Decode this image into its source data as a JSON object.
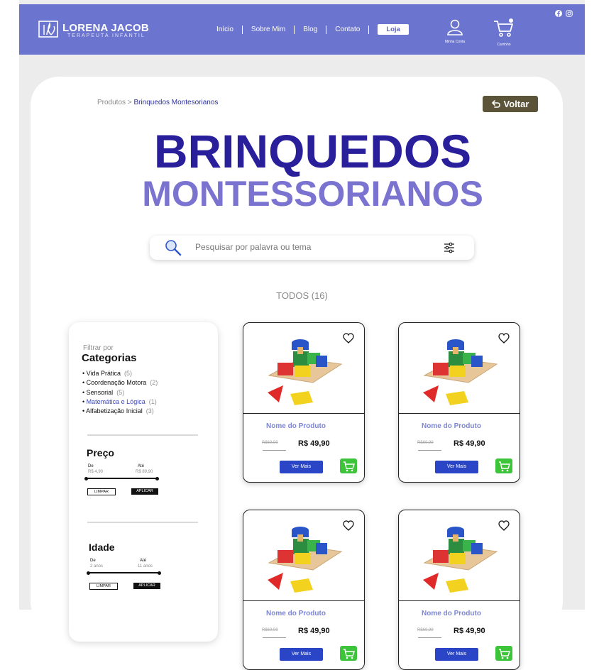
{
  "brand": {
    "name": "LORENA JACOB",
    "subtitle": "TERAPEUTA INFANTIL"
  },
  "nav": {
    "items": [
      "Início",
      "Sobre Mim",
      "Blog",
      "Contato"
    ],
    "store": "Loja"
  },
  "header_icons": {
    "account_label": "Minha Conta",
    "cart_label": "Carrinho",
    "cart_count": "0"
  },
  "breadcrumb": {
    "parent": "Produtos",
    "separator": ">",
    "current": "Brinquedos Montesorianos"
  },
  "back_button": "Voltar",
  "title": {
    "line1": "BRINQUEDOS",
    "line2": "MONTESSORIANOS"
  },
  "search": {
    "placeholder": "Pesquisar por palavra ou tema"
  },
  "results_label": "TODOS (16)",
  "filters": {
    "filter_by": "Filtrar por",
    "categories_title": "Categorias",
    "categories": [
      {
        "name": "Vida Prática",
        "count": "(5)"
      },
      {
        "name": "Coordenação Motora",
        "count": "(2)"
      },
      {
        "name": "Sensorial",
        "count": "(5)"
      },
      {
        "name": "Matemática e Lógica",
        "count": "(1)"
      },
      {
        "name": "Alfabetização Inicial",
        "count": "(3)"
      }
    ],
    "price": {
      "title": "Preço",
      "from_label": "De",
      "to_label": "Até",
      "from_value": "R$ 4,90",
      "to_value": "R$ 89,90",
      "clear": "LIMPAR",
      "apply": "APLICAR"
    },
    "age": {
      "title": "Idade",
      "from_label": "De",
      "to_label": "Até",
      "from_value": "2 anos",
      "to_value": "11 anos",
      "clear": "LIMPAR",
      "apply": "APLICAR"
    }
  },
  "products": [
    {
      "name": "Nome do Produto",
      "old_price": "R$69,99",
      "price": "R$ 49,90",
      "button": "Ver Mais"
    },
    {
      "name": "Nome do Produto",
      "old_price": "R$69,99",
      "price": "R$ 49,90",
      "button": "Ver Mais"
    },
    {
      "name": "Nome do Produto",
      "old_price": "R$69,99",
      "price": "R$ 49,90",
      "button": "Ver Mais"
    },
    {
      "name": "Nome do Produto",
      "old_price": "R$69,99",
      "price": "R$ 49,90",
      "button": "Ver Mais"
    }
  ],
  "colors": {
    "header": "#6b74cf",
    "title_dark": "#2a1f9a",
    "title_light": "#7a73d0",
    "button_blue": "#2a46c6",
    "cart_green": "#3ec43b",
    "back_button": "#5b5438"
  },
  "icons": [
    "facebook-icon",
    "instagram-icon",
    "user-icon",
    "cart-icon",
    "search-icon",
    "filter-icon",
    "heart-icon",
    "undo-icon"
  ]
}
